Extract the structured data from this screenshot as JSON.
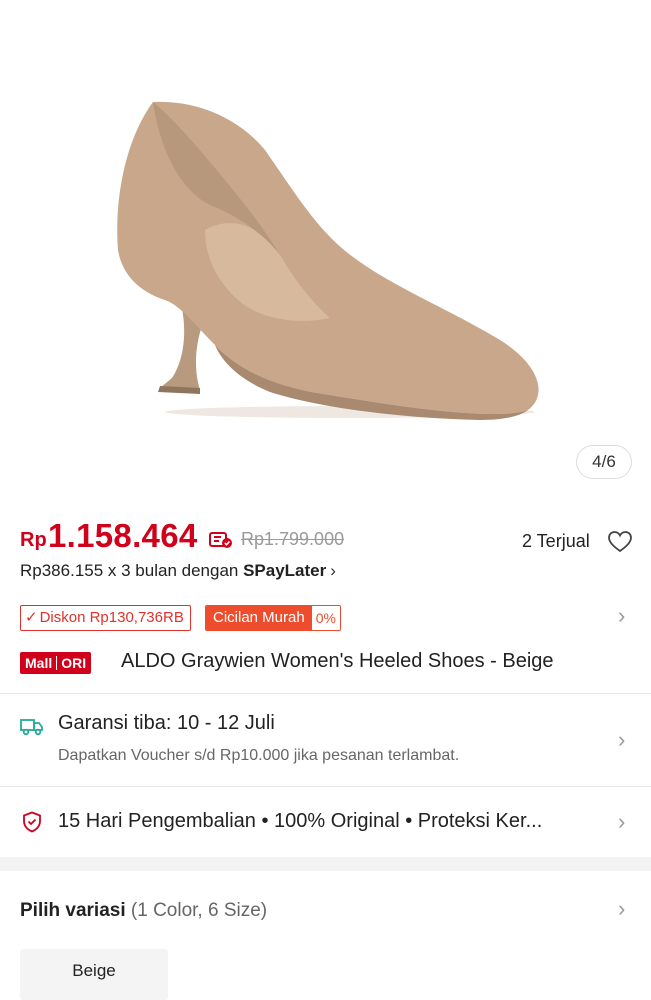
{
  "gallery": {
    "image_alt": "Beige suede pointed-toe heeled pump",
    "counter": "4/6",
    "colors": {
      "shoe": "#c8a78a",
      "shoe_shadow": "#a98a70",
      "shoe_inner": "#d7b99d"
    }
  },
  "price": {
    "currency": "Rp",
    "current": "1.158.464",
    "original": "Rp1.799.000",
    "sold": "2 Terjual",
    "color": "#d0011b"
  },
  "installment": {
    "text": "Rp386.155 x 3 bulan dengan ",
    "provider": "SPayLater",
    "chevron": "›"
  },
  "badges": {
    "discount": "Diskon Rp130,736RB",
    "cicilan_label": "Cicilan Murah",
    "cicilan_rate": "0%"
  },
  "product": {
    "mall_label": "Mall",
    "ori_label": "ORI",
    "title": "ALDO Graywien Women's Heeled Shoes - Beige"
  },
  "shipping": {
    "title": "Garansi tiba: 10 - 12 Juli",
    "subtitle": "Dapatkan Voucher s/d Rp10.000 jika pesanan terlambat."
  },
  "guarantee": {
    "text": "15 Hari Pengembalian  •  100% Original  •  Proteksi Ker..."
  },
  "variation": {
    "label": "Pilih variasi",
    "count": "(1 Color, 6 Size)",
    "options": [
      "Beige"
    ]
  },
  "icons": {
    "price_tag": "voucher-tag-icon",
    "heart": "heart-icon",
    "truck": "truck-icon",
    "shield": "shield-icon",
    "chevron": "chevron-right-icon"
  }
}
